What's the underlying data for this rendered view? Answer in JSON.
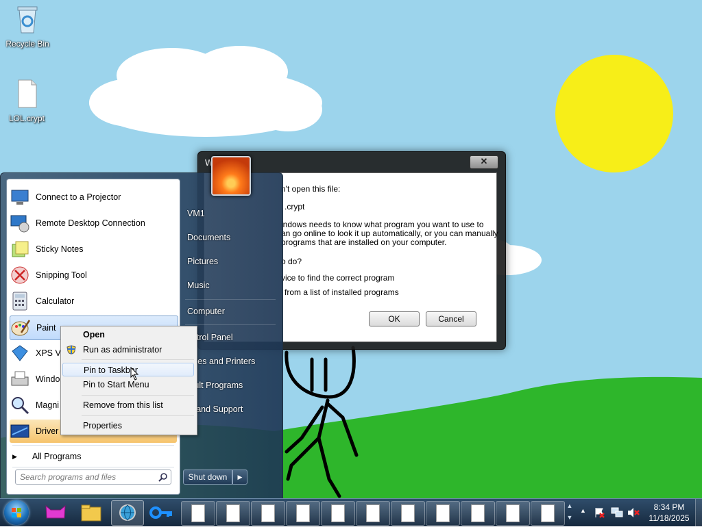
{
  "desktop": {
    "icons": [
      {
        "label": "Recycle Bin"
      },
      {
        "label": "LOL.crypt"
      }
    ]
  },
  "dialog": {
    "title": "W",
    "close_label": "✕",
    "lines": [
      "n't open this file:",
      ".crypt",
      "indows needs to know what program you want to use to",
      "an go online to look it up automatically, or you can manually",
      "programs that are installed on your computer.",
      "o do?",
      "vice to find the correct program",
      "from a list of installed programs"
    ],
    "ok_label": "OK",
    "cancel_label": "Cancel"
  },
  "start_menu": {
    "programs": [
      {
        "label": "Connect to a Projector",
        "icon": "projector-icon"
      },
      {
        "label": "Remote Desktop Connection",
        "icon": "remote-desktop-icon"
      },
      {
        "label": "Sticky Notes",
        "icon": "sticky-notes-icon"
      },
      {
        "label": "Snipping Tool",
        "icon": "snipping-tool-icon"
      },
      {
        "label": "Calculator",
        "icon": "calculator-icon"
      },
      {
        "label": "Paint",
        "icon": "paint-icon"
      },
      {
        "label": "XPS Vi",
        "icon": "xps-viewer-icon"
      },
      {
        "label": "Windo",
        "icon": "fax-scan-icon"
      },
      {
        "label": "Magni",
        "icon": "magnifier-icon"
      },
      {
        "label": "Driver",
        "icon": "driver-icon"
      }
    ],
    "all_programs": "All Programs",
    "search_placeholder": "Search programs and files",
    "right_items": [
      "VM1",
      "Documents",
      "Pictures",
      "Music",
      "Computer",
      "Control Panel",
      "vices and Printers",
      "fault Programs",
      "lp and Support"
    ],
    "right_items_display": [
      "VM1",
      "Documents",
      "Pictures",
      "Music",
      "Computer",
      "ontrol Panel",
      "vices and Printers",
      "fault Programs",
      "lp and Support"
    ],
    "shutdown_label": "Shut down",
    "shutdown_arrow": "▶"
  },
  "context_menu": {
    "items": [
      "Open",
      "Run as administrator",
      "Pin to Taskbar",
      "Pin to Start Menu",
      "Remove from this list",
      "Properties"
    ]
  },
  "taskbar": {
    "time": "8:34 PM",
    "date": "11/18/2025",
    "document_buttons": 11
  }
}
